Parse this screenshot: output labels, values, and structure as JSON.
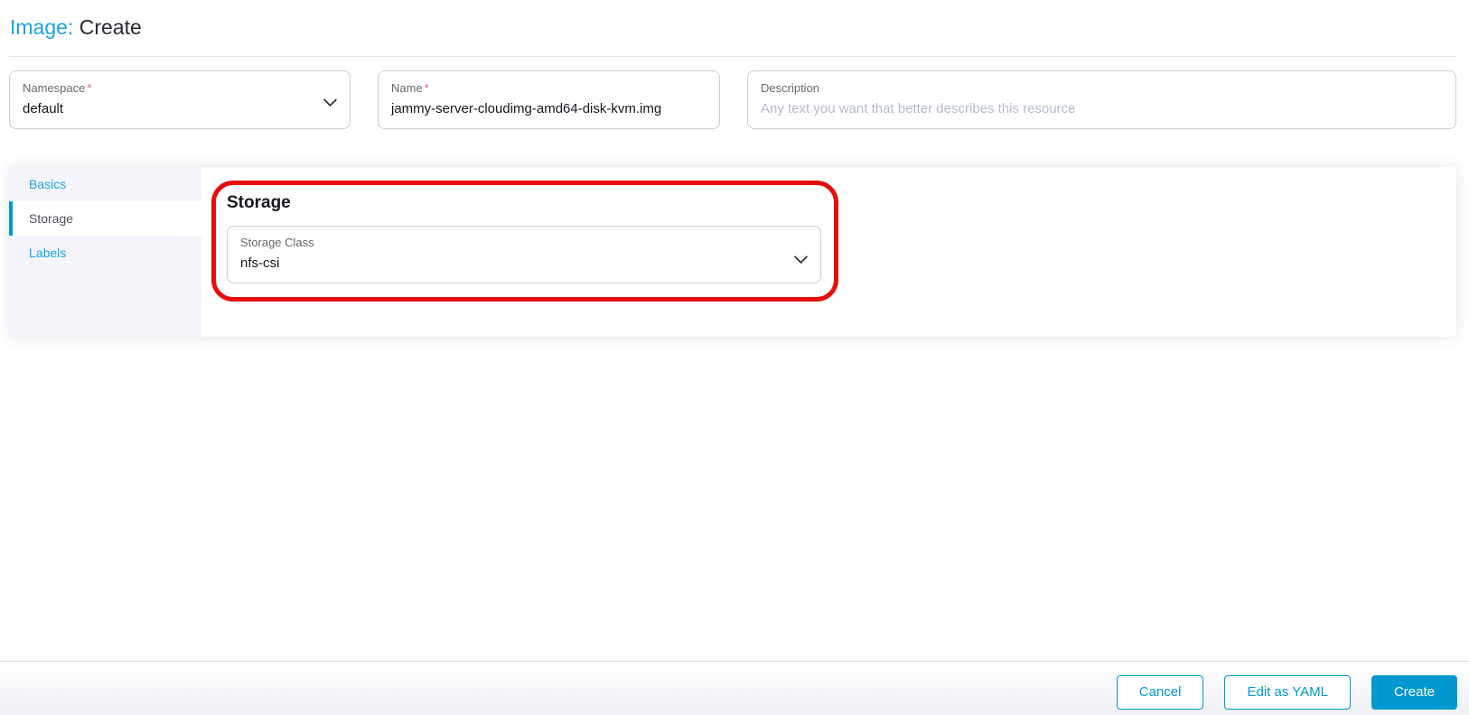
{
  "header": {
    "resource": "Image:",
    "action": "Create"
  },
  "form": {
    "namespace": {
      "label": "Namespace",
      "required_mark": "*",
      "value": "default"
    },
    "name": {
      "label": "Name",
      "required_mark": "*",
      "value": "jammy-server-cloudimg-amd64-disk-kvm.img"
    },
    "description": {
      "label": "Description",
      "placeholder": "Any text you want that better describes this resource"
    }
  },
  "tabs": {
    "active": "Storage",
    "items": [
      {
        "label": "Basics"
      },
      {
        "label": "Storage"
      },
      {
        "label": "Labels"
      }
    ]
  },
  "storage_section": {
    "heading": "Storage",
    "storage_class": {
      "label": "Storage Class",
      "value": "nfs-csi"
    }
  },
  "footer": {
    "cancel_label": "Cancel",
    "edit_yaml_label": "Edit as YAML",
    "create_label": "Create"
  },
  "colors": {
    "primary_button": "#0099cf",
    "link_text": "#1ca3dd",
    "active_tab_bar": "#0099cf",
    "highlight_ring": "#e60d0d",
    "required_asterisk": "#f05a5a"
  }
}
